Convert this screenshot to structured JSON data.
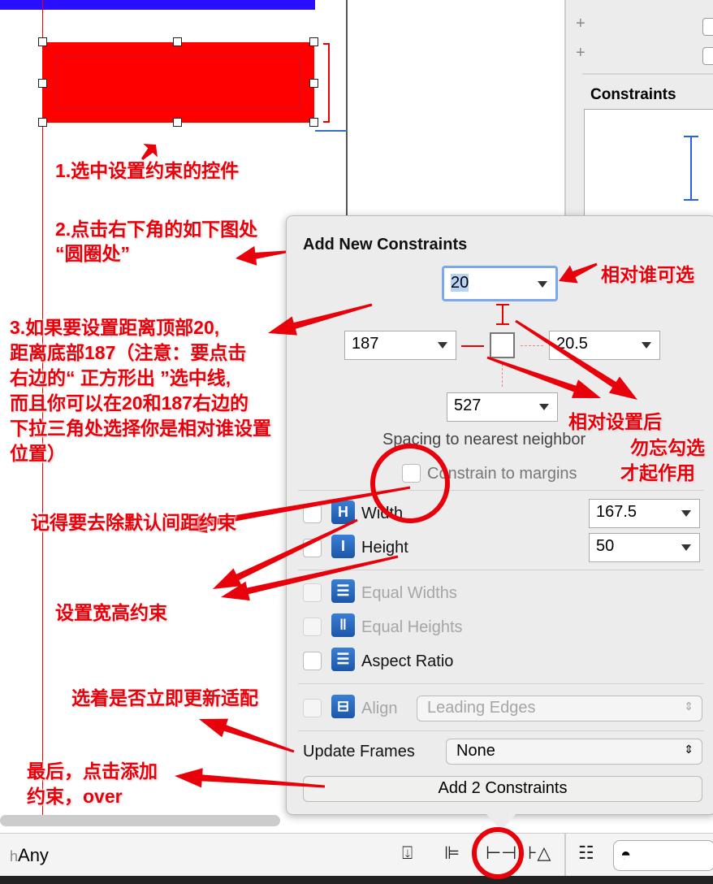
{
  "canvas": {
    "size_class_label_prefix": "h",
    "size_class_label": "Any"
  },
  "inspector": {
    "constraints_heading": "Constraints"
  },
  "popover": {
    "title": "Add New Constraints",
    "top_value": "20",
    "left_value": "187",
    "right_value": "20.5",
    "bottom_value": "527",
    "spacing_label": "Spacing to nearest neighbor",
    "constrain_margins_label": "Constrain to margins",
    "width_label": "Width",
    "width_value": "167.5",
    "height_label": "Height",
    "height_value": "50",
    "equal_widths_label": "Equal Widths",
    "equal_heights_label": "Equal Heights",
    "aspect_ratio_label": "Aspect Ratio",
    "align_label": "Align",
    "align_value": "Leading Edges",
    "update_frames_label": "Update Frames",
    "update_frames_value": "None",
    "add_button": "Add 2 Constraints"
  },
  "annotations": {
    "step1": "1.选中设置约束的控件",
    "step2_line1": "2.点击右下角的如下图处",
    "step2_line2": "“圆圈处”",
    "relative": "相对谁可选",
    "step3": [
      "3.如果要设置距离顶部20,",
      "距离底部187（注意：要点击",
      "右边的“ 正方形出 ”选中线,",
      "而且你可以在20和187右边的",
      "下拉三角处选择你是相对谁设置",
      "位置）"
    ],
    "after_set": "相对设置后",
    "dont_forget": "勿忘勾选",
    "takes_effect": "才起作用",
    "remove_margin": "记得要去除默认间距约束",
    "size": "设置宽高约束",
    "update": "选着是否立即更新适配",
    "final_line1": "最后，点击添加",
    "final_line2": "约束，over"
  },
  "colors": {
    "annotation": "#e8000a",
    "selected_view": "#ff0000",
    "nav_bar": "#2a0fff",
    "icon_blue": "#2a6bc4"
  }
}
